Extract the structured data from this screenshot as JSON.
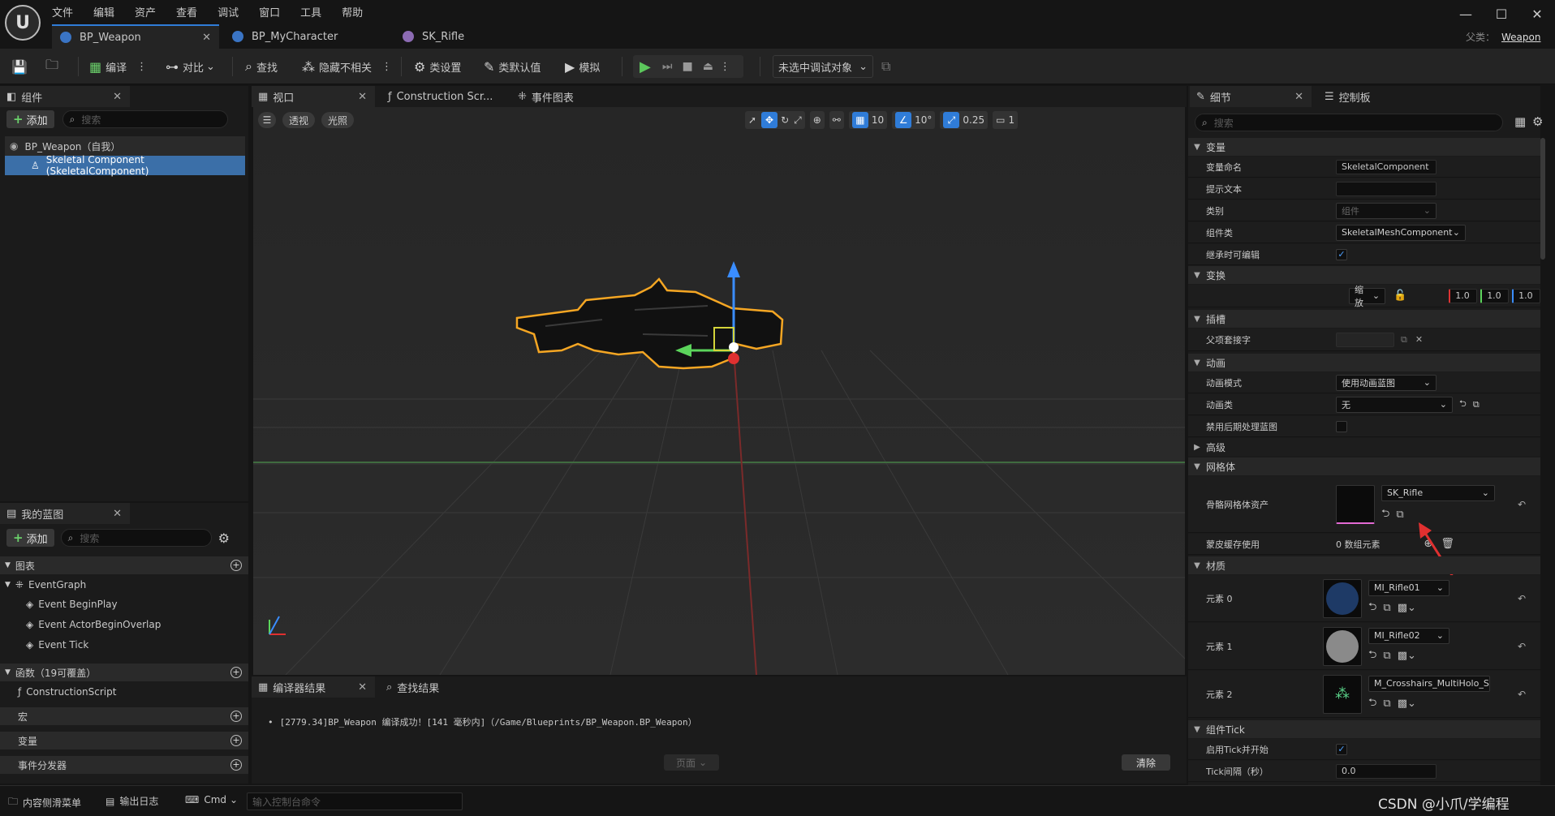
{
  "menu": [
    "文件",
    "编辑",
    "资产",
    "查看",
    "调试",
    "窗口",
    "工具",
    "帮助"
  ],
  "tabs": [
    {
      "label": "BP_Weapon",
      "active": true
    },
    {
      "label": "BP_MyCharacter",
      "active": false
    },
    {
      "label": "SK_Rifle",
      "active": false
    }
  ],
  "parent_class": {
    "label": "父类：",
    "value": "Weapon"
  },
  "toolbar": {
    "compile": "编译",
    "diff": "对比",
    "find": "查找",
    "hide_unrelated": "隐藏不相关",
    "class_settings": "类设置",
    "class_defaults": "类默认值",
    "simulate": "模拟",
    "debug_target": "未选中调试对象"
  },
  "components_panel": {
    "title": "组件",
    "add": "添加",
    "search_placeholder": "搜索",
    "root": "BP_Weapon（自我）",
    "child": "Skeletal Component (SkeletalComponent)"
  },
  "my_blueprint": {
    "title": "我的蓝图",
    "add": "添加",
    "search_placeholder": "搜索",
    "graphs_header": "图表",
    "event_graph": "EventGraph",
    "events": [
      "Event BeginPlay",
      "Event ActorBeginOverlap",
      "Event Tick"
    ],
    "functions_header": "函数（19可覆盖）",
    "construction_script": "ConstructionScript",
    "macros_header": "宏",
    "variables_header": "变量",
    "dispatchers_header": "事件分发器"
  },
  "center_tabs": {
    "viewport": "视口",
    "construction": "Construction Scr...",
    "event_graph": "事件图表"
  },
  "viewport": {
    "perspective": "透视",
    "lighting": "光照",
    "grid_snap": "10",
    "rot_snap": "10°",
    "scale_snap": "0.25",
    "cam_speed": "1"
  },
  "compiler": {
    "tab": "编译器结果",
    "find_tab": "查找结果",
    "message": "[2779.34]BP_Weapon 编译成功！[141 毫秒内]（/Game/Blueprints/BP_Weapon.BP_Weapon）",
    "page": "页面",
    "clear": "清除"
  },
  "details": {
    "tab": "细节",
    "control_tab": "控制板",
    "search_placeholder": "搜索",
    "variable": {
      "header": "变量",
      "name_label": "变量命名",
      "name_value": "SkeletalComponent",
      "tooltip_label": "提示文本",
      "category_label": "类别",
      "category_value": "组件",
      "component_class_label": "组件类",
      "component_class_value": "SkeletalMeshComponent",
      "editable_label": "继承时可编辑",
      "editable_checked": "✓"
    },
    "transform": {
      "header": "变换",
      "mode": "缩放",
      "x": "1.0",
      "y": "1.0",
      "z": "1.0"
    },
    "sockets": {
      "header": "插槽",
      "parent_socket_label": "父项套接字"
    },
    "animation": {
      "header": "动画",
      "mode_label": "动画模式",
      "mode_value": "使用动画蓝图",
      "class_label": "动画类",
      "class_value": "无",
      "disable_pp_label": "禁用后期处理蓝图"
    },
    "advanced_header": "高级",
    "mesh": {
      "header": "网格体",
      "asset_label": "骨骼网格体资产",
      "asset_value": "SK_Rifle",
      "skin_cache_label": "蒙皮缓存使用",
      "skin_cache_value": "0 数组元素"
    },
    "materials": {
      "header": "材质",
      "items": [
        {
          "label": "元素 0",
          "value": "MI_Rifle01"
        },
        {
          "label": "元素 1",
          "value": "MI_Rifle02"
        },
        {
          "label": "元素 2",
          "value": "M_Crosshairs_MultiHolo_Sc"
        }
      ]
    },
    "tick": {
      "header": "组件Tick",
      "start_label": "启用Tick并开始",
      "start_checked": "✓",
      "interval_label": "Tick间隔（秒）",
      "interval_value": "0.0"
    }
  },
  "statusbar": {
    "content_drawer": "内容侧滑菜单",
    "output_log": "输出日志",
    "cmd": "Cmd",
    "console_placeholder": "输入控制台命令",
    "watermark": "CSDN @小爪/学编程"
  },
  "colors": {
    "accent": "#2f7cd8",
    "play": "#5cc75c",
    "selection": "#3b6fa8",
    "outline": "#f5a623"
  }
}
